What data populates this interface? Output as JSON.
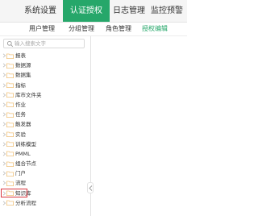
{
  "topnav": {
    "tabs": [
      {
        "label": "系统设置",
        "active": false
      },
      {
        "label": "认证授权",
        "active": true
      },
      {
        "label": "日志管理",
        "active": false
      },
      {
        "label": "监控预警",
        "active": false
      }
    ]
  },
  "subnav": {
    "items": [
      {
        "label": "用户管理",
        "active": false
      },
      {
        "label": "分组管理",
        "active": false
      },
      {
        "label": "角色管理",
        "active": false
      },
      {
        "label": "授权编辑",
        "active": true
      }
    ]
  },
  "search": {
    "placeholder": "输入搜索文字",
    "value": ""
  },
  "tree": {
    "items": [
      {
        "label": "报表"
      },
      {
        "label": "数据源"
      },
      {
        "label": "数据集"
      },
      {
        "label": "指标"
      },
      {
        "label": "库市文件夹"
      },
      {
        "label": "作业"
      },
      {
        "label": "任务"
      },
      {
        "label": "触发器"
      },
      {
        "label": "实验"
      },
      {
        "label": "训练模型"
      },
      {
        "label": "PMML"
      },
      {
        "label": "组合节点"
      },
      {
        "label": "门户"
      },
      {
        "label": "流程"
      },
      {
        "label": "知识库",
        "highlighted": true
      },
      {
        "label": "分析流程"
      }
    ]
  },
  "colors": {
    "accent": "#26a76a",
    "folder": "#f0c27b",
    "highlight": "#d9363e"
  }
}
